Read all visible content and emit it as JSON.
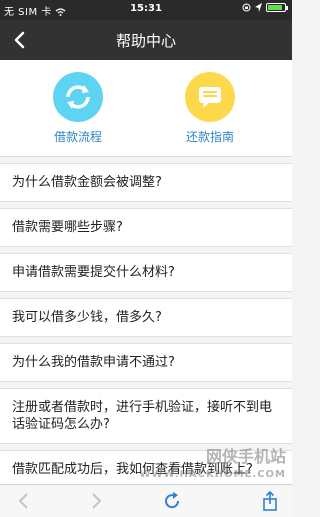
{
  "status_bar": {
    "carrier": "无 SIM 卡",
    "time": "15:31",
    "battery_color": "#5fe04b"
  },
  "nav": {
    "title": "帮助中心",
    "back_icon": "chevron-left-icon"
  },
  "entries": [
    {
      "label": "借款流程",
      "icon": "refresh-icon",
      "color": "#5fd3f2"
    },
    {
      "label": "还款指南",
      "icon": "chat-bubble-icon",
      "color": "#fcd94b"
    }
  ],
  "faq": [
    "为什么借款金额会被调整?",
    "借款需要哪些步骤?",
    "申请借款需要提交什么材料?",
    "我可以借多少钱，借多久?",
    "为什么我的借款申请不通过?",
    "注册或者借款时，进行手机验证，接听不到电话验证码怎么办?",
    "借款匹配成功后，我如何查看借款到账上?"
  ],
  "toolbar": {
    "icons": [
      "back-arrow-icon",
      "forward-arrow-icon",
      "reload-icon",
      "share-icon"
    ]
  },
  "watermark": {
    "text": "网侠手机站",
    "sub": "WWW.HACKHOME.COM"
  }
}
